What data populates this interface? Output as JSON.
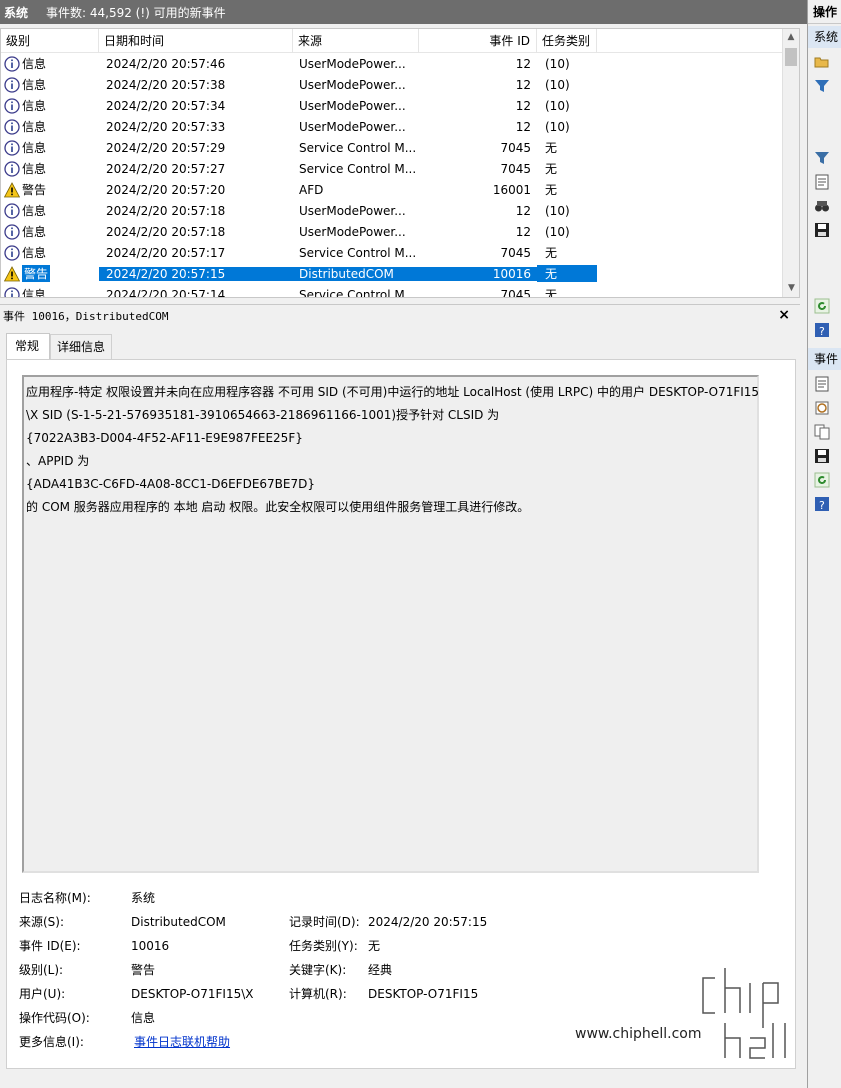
{
  "titlebar": {
    "name": "系统",
    "info": "事件数: 44,592 (!) 可用的新事件"
  },
  "columns": {
    "level": "级别",
    "date": "日期和时间",
    "source": "来源",
    "event_id": "事件 ID",
    "task": "任务类别"
  },
  "rows": [
    {
      "level": "信息",
      "type": "info",
      "date": "2024/2/20 20:57:46",
      "source": "UserModePower...",
      "id": "12",
      "task": "(10)"
    },
    {
      "level": "信息",
      "type": "info",
      "date": "2024/2/20 20:57:38",
      "source": "UserModePower...",
      "id": "12",
      "task": "(10)"
    },
    {
      "level": "信息",
      "type": "info",
      "date": "2024/2/20 20:57:34",
      "source": "UserModePower...",
      "id": "12",
      "task": "(10)"
    },
    {
      "level": "信息",
      "type": "info",
      "date": "2024/2/20 20:57:33",
      "source": "UserModePower...",
      "id": "12",
      "task": "(10)"
    },
    {
      "level": "信息",
      "type": "info",
      "date": "2024/2/20 20:57:29",
      "source": "Service Control M...",
      "id": "7045",
      "task": "无"
    },
    {
      "level": "信息",
      "type": "info",
      "date": "2024/2/20 20:57:27",
      "source": "Service Control M...",
      "id": "7045",
      "task": "无"
    },
    {
      "level": "警告",
      "type": "warn",
      "date": "2024/2/20 20:57:20",
      "source": "AFD",
      "id": "16001",
      "task": "无"
    },
    {
      "level": "信息",
      "type": "info",
      "date": "2024/2/20 20:57:18",
      "source": "UserModePower...",
      "id": "12",
      "task": "(10)"
    },
    {
      "level": "信息",
      "type": "info",
      "date": "2024/2/20 20:57:18",
      "source": "UserModePower...",
      "id": "12",
      "task": "(10)"
    },
    {
      "level": "信息",
      "type": "info",
      "date": "2024/2/20 20:57:17",
      "source": "Service Control M...",
      "id": "7045",
      "task": "无"
    },
    {
      "level": "警告",
      "type": "warn",
      "date": "2024/2/20 20:57:15",
      "source": "DistributedCOM",
      "id": "10016",
      "task": "无",
      "selected": true
    },
    {
      "level": "信息",
      "type": "info",
      "date": "2024/2/20 20:57:14",
      "source": "Service Control M...",
      "id": "7045",
      "task": "无"
    }
  ],
  "detail": {
    "header": "事件 10016，DistributedCOM",
    "close": "×",
    "tabs": [
      "常规",
      "详细信息"
    ],
    "message": [
      "应用程序-特定 权限设置并未向在应用程序容器 不可用 SID (不可用)中运行的地址 LocalHost (使用 LRPC) 中的用户 DESKTOP-O71FI15",
      "\\X SID (S-1-5-21-576935181-3910654663-2186961166-1001)授予针对 CLSID 为",
      "{7022A3B3-D004-4F52-AF11-E9E987FEE25F}",
      "、APPID 为",
      "{ADA41B3C-C6FD-4A08-8CC1-D6EFDE67BE7D}",
      " 的 COM 服务器应用程序的 本地 启动 权限。此安全权限可以使用组件服务管理工具进行修改。"
    ],
    "props": {
      "log_name_label": "日志名称(M):",
      "log_name": "系统",
      "source_label": "来源(S):",
      "source": "DistributedCOM",
      "logged_label": "记录时间(D):",
      "logged": "2024/2/20 20:57:15",
      "event_id_label": "事件 ID(E):",
      "event_id": "10016",
      "task_label": "任务类别(Y):",
      "task": "无",
      "level_label": "级别(L):",
      "level": "警告",
      "keywords_label": "关键字(K):",
      "keywords": "经典",
      "user_label": "用户(U):",
      "user": "DESKTOP-O71FI15\\X",
      "computer_label": "计算机(R):",
      "computer": "DESKTOP-O71FI15",
      "opcode_label": "操作代码(O):",
      "opcode": "信息",
      "more_label": "更多信息(I):",
      "more_link": "事件日志联机帮助"
    }
  },
  "actions": {
    "header": "操作",
    "section1": "系统",
    "section2": "事件"
  },
  "watermark": {
    "text": "www.chiphell.com",
    "logo": "chip hell"
  }
}
